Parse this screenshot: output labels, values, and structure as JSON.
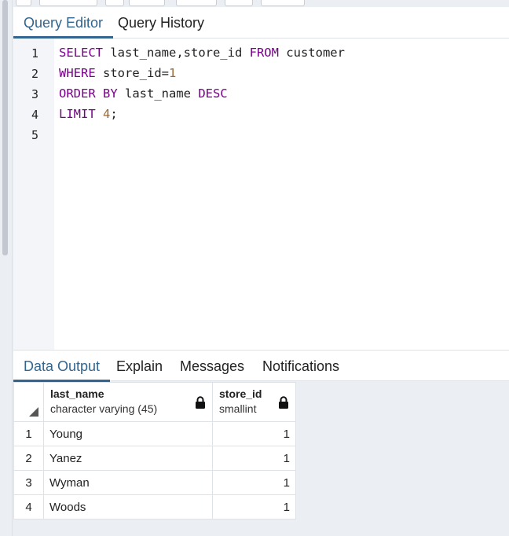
{
  "query_tabs": [
    {
      "label": "Query Editor",
      "active": true
    },
    {
      "label": "Query History",
      "active": false
    }
  ],
  "editor": {
    "line_numbers": [
      "1",
      "2",
      "3",
      "4",
      "5"
    ],
    "lines": [
      [
        {
          "t": "SELECT",
          "k": "kw"
        },
        {
          "t": " last_name,store_id ",
          "k": ""
        },
        {
          "t": "FROM",
          "k": "kw"
        },
        {
          "t": " customer",
          "k": ""
        }
      ],
      [
        {
          "t": "WHERE",
          "k": "kw"
        },
        {
          "t": " store_id=",
          "k": ""
        },
        {
          "t": "1",
          "k": "num2"
        }
      ],
      [
        {
          "t": "ORDER BY",
          "k": "kw"
        },
        {
          "t": " last_name ",
          "k": ""
        },
        {
          "t": "DESC",
          "k": "kw"
        }
      ],
      [
        {
          "t": "LIMIT",
          "k": "kw"
        },
        {
          "t": " ",
          "k": ""
        },
        {
          "t": "4",
          "k": "num2"
        },
        {
          "t": ";",
          "k": ""
        }
      ],
      []
    ]
  },
  "output_tabs": [
    {
      "label": "Data Output",
      "active": true
    },
    {
      "label": "Explain",
      "active": false
    },
    {
      "label": "Messages",
      "active": false
    },
    {
      "label": "Notifications",
      "active": false
    }
  ],
  "grid": {
    "columns": [
      {
        "name": "last_name",
        "type": "character varying (45)"
      },
      {
        "name": "store_id",
        "type": "smallint"
      }
    ],
    "rows": [
      {
        "n": "1",
        "last_name": "Young",
        "store_id": "1"
      },
      {
        "n": "2",
        "last_name": "Yanez",
        "store_id": "1"
      },
      {
        "n": "3",
        "last_name": "Wyman",
        "store_id": "1"
      },
      {
        "n": "4",
        "last_name": "Woods",
        "store_id": "1"
      }
    ]
  },
  "colors": {
    "accent": "#326690",
    "keyword": "#770088",
    "number": "#9a6a34"
  }
}
